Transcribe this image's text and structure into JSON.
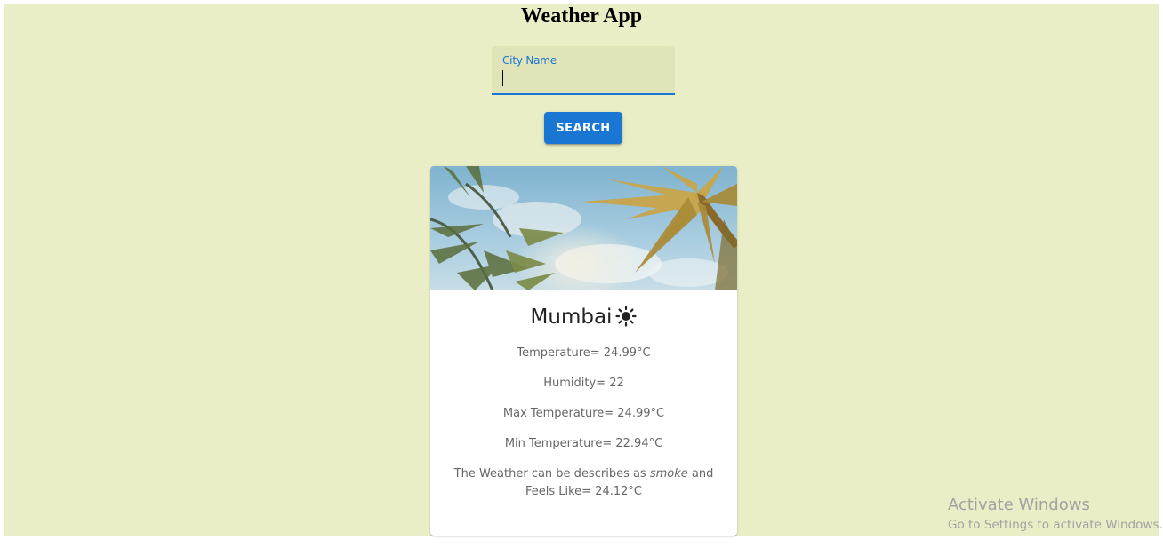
{
  "app": {
    "title": "Weather App"
  },
  "search": {
    "field_label": "City Name",
    "value": "",
    "button_label": "SEARCH"
  },
  "card": {
    "city": "Mumbai",
    "weather_icon": "sun-icon",
    "temperature": "Temperature= 24.99°C",
    "humidity": "Humidity= 22",
    "max_temperature": "Max Temperature= 24.99°C",
    "min_temperature": "Min Temperature= 22.94°C",
    "description_prefix": "The Weather can be describes as ",
    "description_value": "smoke",
    "description_suffix": " and Feels Like= 24.12°C"
  },
  "colors": {
    "background": "#e9eec6",
    "accent": "#1976d2",
    "field_background": "#e0e4b8"
  },
  "watermark": {
    "line1": "Activate Windows",
    "line2": "Go to Settings to activate Windows."
  }
}
